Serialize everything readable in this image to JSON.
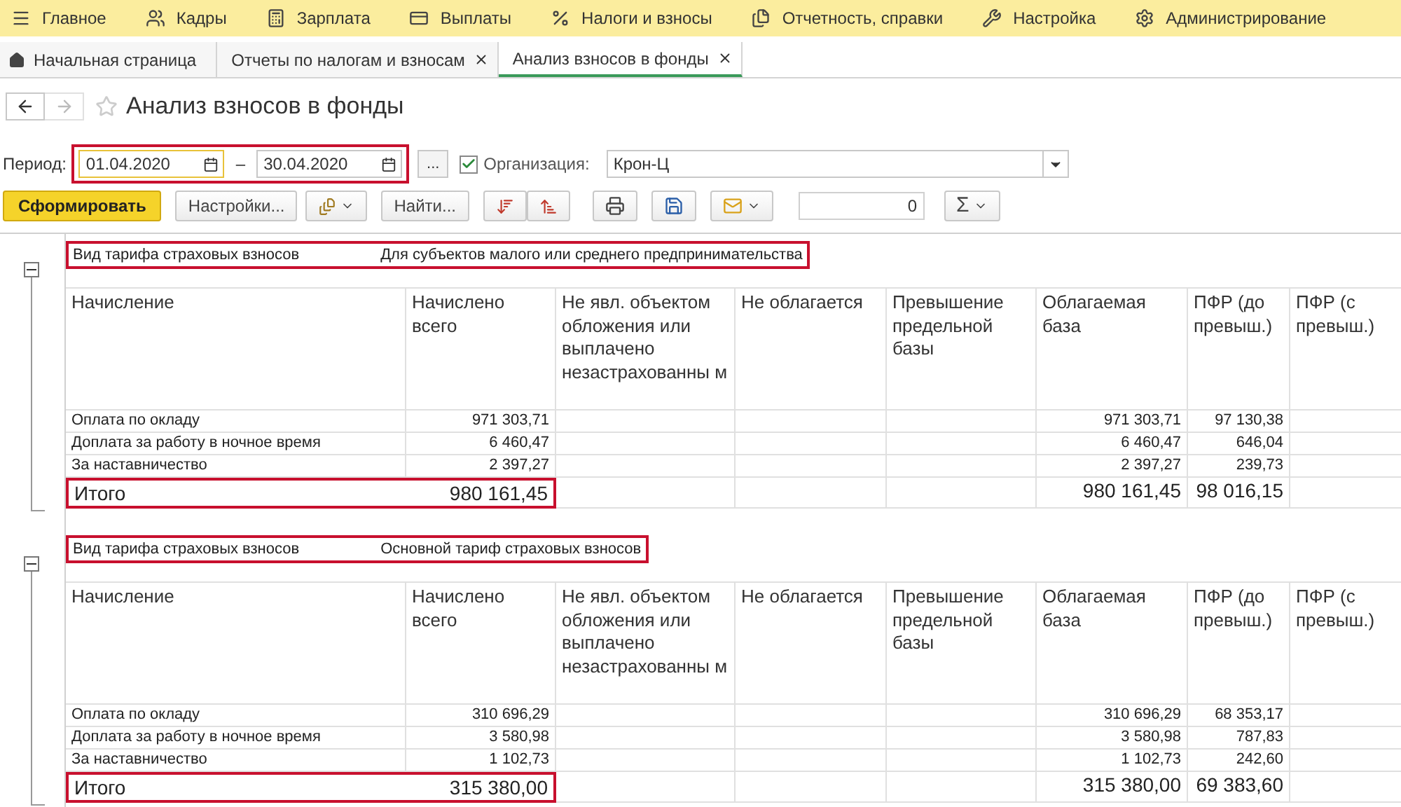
{
  "menu": [
    {
      "label": "Главное"
    },
    {
      "label": "Кадры"
    },
    {
      "label": "Зарплата"
    },
    {
      "label": "Выплаты"
    },
    {
      "label": "Налоги и взносы"
    },
    {
      "label": "Отчетность, справки"
    },
    {
      "label": "Настройка"
    },
    {
      "label": "Администрирование"
    }
  ],
  "tabs": [
    {
      "label": "Начальная страница",
      "kind": "home",
      "selected": false
    },
    {
      "label": "Отчеты по налогам и взносам",
      "kind": "closable",
      "selected": false
    },
    {
      "label": "Анализ взносов в фонды",
      "kind": "closable",
      "selected": true
    }
  ],
  "title": "Анализ взносов в фонды",
  "filters": {
    "period_label": "Период:",
    "date_from": "01.04.2020",
    "dash": "–",
    "date_to": "30.04.2020",
    "highlighted": true,
    "more_button": "...",
    "organization_checked": true,
    "organization_label": "Организация:",
    "organization": "Крон-Ц"
  },
  "toolbar": {
    "generate": "Сформировать",
    "settings": "Настройки...",
    "find": "Найти...",
    "counter": "0",
    "sum": "Σ"
  },
  "sections": [
    {
      "expanded": true,
      "tariff_label": "Вид тарифа страховых взносов",
      "tariff": "Для субъектов малого или среднего предпринимательства",
      "highlighted": true,
      "columns": [
        "Начисление",
        "Начислено всего",
        "Не явл. объектом обложения или выплачено незастрахованны м",
        "Не облагается",
        "Превышение предельной базы",
        "Облагаемая база",
        "ПФР (до превыш.)",
        "ПФР (с превыш.)"
      ],
      "rows": [
        {
          "cells": [
            "Оплата по окладу",
            "971 303,71",
            null,
            null,
            null,
            "971 303,71",
            "97 130,38",
            null
          ]
        },
        {
          "cells": [
            "Доплата за работу в ночное время",
            "6 460,47",
            null,
            null,
            null,
            "6 460,47",
            "646,04",
            null
          ]
        },
        {
          "cells": [
            "За наставничество",
            "2 397,27",
            null,
            null,
            null,
            "2 397,27",
            "239,73",
            null
          ]
        }
      ],
      "total": {
        "highlighted": true,
        "cells": [
          "Итого",
          "980 161,45",
          null,
          null,
          null,
          "980 161,45",
          "98 016,15",
          null
        ]
      }
    },
    {
      "expanded": true,
      "tariff_label": "Вид тарифа страховых взносов",
      "tariff": "Основной тариф страховых взносов",
      "highlighted": true,
      "columns": [
        "Начисление",
        "Начислено всего",
        "Не явл. объектом обложения или выплачено незастрахованны м",
        "Не облагается",
        "Превышение предельной базы",
        "Облагаемая база",
        "ПФР (до превыш.)",
        "ПФР (с превыш.)"
      ],
      "rows": [
        {
          "cells": [
            "Оплата по окладу",
            "310 696,29",
            null,
            null,
            null,
            "310 696,29",
            "68 353,17",
            null
          ]
        },
        {
          "cells": [
            "Доплата за работу в ночное время",
            "3 580,98",
            null,
            null,
            null,
            "3 580,98",
            "787,83",
            null
          ]
        },
        {
          "cells": [
            "За наставничество",
            "1 102,73",
            null,
            null,
            null,
            "1 102,73",
            "242,60",
            null
          ]
        }
      ],
      "total": {
        "highlighted": true,
        "cells": [
          "Итого",
          "315 380,00",
          null,
          null,
          null,
          "315 380,00",
          "69 383,60",
          null
        ]
      }
    }
  ]
}
